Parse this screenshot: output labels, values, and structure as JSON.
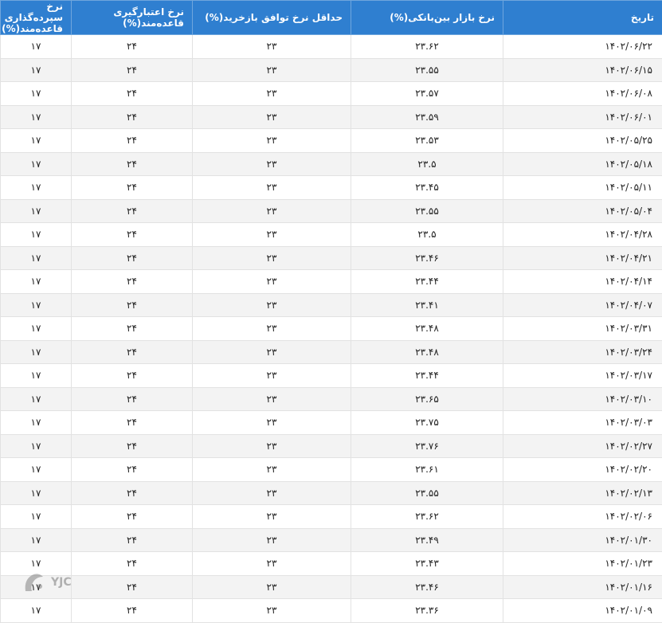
{
  "table": {
    "headers": [
      "تاریخ",
      "نرخ بازار بین‌بانکی(%)",
      "حداقل نرخ توافق بازخرید(%)",
      "نرخ اعتبارگیری قاعده‌مند(%)",
      "نرخ سپرده‌گذاری قاعده‌مند(%)"
    ],
    "rows": [
      [
        "۱۴۰۲/۰۶/۲۲",
        "۲۳.۶۲",
        "۲۳",
        "۲۴",
        "۱۷"
      ],
      [
        "۱۴۰۲/۰۶/۱۵",
        "۲۳.۵۵",
        "۲۳",
        "۲۴",
        "۱۷"
      ],
      [
        "۱۴۰۲/۰۶/۰۸",
        "۲۳.۵۷",
        "۲۳",
        "۲۴",
        "۱۷"
      ],
      [
        "۱۴۰۲/۰۶/۰۱",
        "۲۳.۵۹",
        "۲۳",
        "۲۴",
        "۱۷"
      ],
      [
        "۱۴۰۲/۰۵/۲۵",
        "۲۳.۵۳",
        "۲۳",
        "۲۴",
        "۱۷"
      ],
      [
        "۱۴۰۲/۰۵/۱۸",
        "۲۳.۵",
        "۲۳",
        "۲۴",
        "۱۷"
      ],
      [
        "۱۴۰۲/۰۵/۱۱",
        "۲۳.۴۵",
        "۲۳",
        "۲۴",
        "۱۷"
      ],
      [
        "۱۴۰۲/۰۵/۰۴",
        "۲۳.۵۵",
        "۲۳",
        "۲۴",
        "۱۷"
      ],
      [
        "۱۴۰۲/۰۴/۲۸",
        "۲۳.۵",
        "۲۳",
        "۲۴",
        "۱۷"
      ],
      [
        "۱۴۰۲/۰۴/۲۱",
        "۲۳.۴۶",
        "۲۳",
        "۲۴",
        "۱۷"
      ],
      [
        "۱۴۰۲/۰۴/۱۴",
        "۲۳.۴۴",
        "۲۳",
        "۲۴",
        "۱۷"
      ],
      [
        "۱۴۰۲/۰۴/۰۷",
        "۲۳.۴۱",
        "۲۳",
        "۲۴",
        "۱۷"
      ],
      [
        "۱۴۰۲/۰۳/۳۱",
        "۲۳.۴۸",
        "۲۳",
        "۲۴",
        "۱۷"
      ],
      [
        "۱۴۰۲/۰۳/۲۴",
        "۲۳.۴۸",
        "۲۳",
        "۲۴",
        "۱۷"
      ],
      [
        "۱۴۰۲/۰۳/۱۷",
        "۲۳.۴۴",
        "۲۳",
        "۲۴",
        "۱۷"
      ],
      [
        "۱۴۰۲/۰۳/۱۰",
        "۲۳.۶۵",
        "۲۳",
        "۲۴",
        "۱۷"
      ],
      [
        "۱۴۰۲/۰۳/۰۳",
        "۲۳.۷۵",
        "۲۳",
        "۲۴",
        "۱۷"
      ],
      [
        "۱۴۰۲/۰۲/۲۷",
        "۲۳.۷۶",
        "۲۳",
        "۲۴",
        "۱۷"
      ],
      [
        "۱۴۰۲/۰۲/۲۰",
        "۲۳.۶۱",
        "۲۳",
        "۲۴",
        "۱۷"
      ],
      [
        "۱۴۰۲/۰۲/۱۳",
        "۲۳.۵۵",
        "۲۳",
        "۲۴",
        "۱۷"
      ],
      [
        "۱۴۰۲/۰۲/۰۶",
        "۲۳.۶۲",
        "۲۳",
        "۲۴",
        "۱۷"
      ],
      [
        "۱۴۰۲/۰۱/۳۰",
        "۲۳.۴۹",
        "۲۳",
        "۲۴",
        "۱۷"
      ],
      [
        "۱۴۰۲/۰۱/۲۳",
        "۲۳.۴۳",
        "۲۳",
        "۲۴",
        "۱۷"
      ],
      [
        "۱۴۰۲/۰۱/۱۶",
        "۲۳.۴۶",
        "۲۳",
        "۲۴",
        "۱۷"
      ],
      [
        "۱۴۰۲/۰۱/۰۹",
        "۲۳.۳۶",
        "۲۳",
        "۲۴",
        "۱۷"
      ]
    ]
  },
  "watermark": {
    "text": "YJC"
  },
  "colors": {
    "header_bg": "#2f7fd0",
    "stripe": "#f3f3f3"
  }
}
